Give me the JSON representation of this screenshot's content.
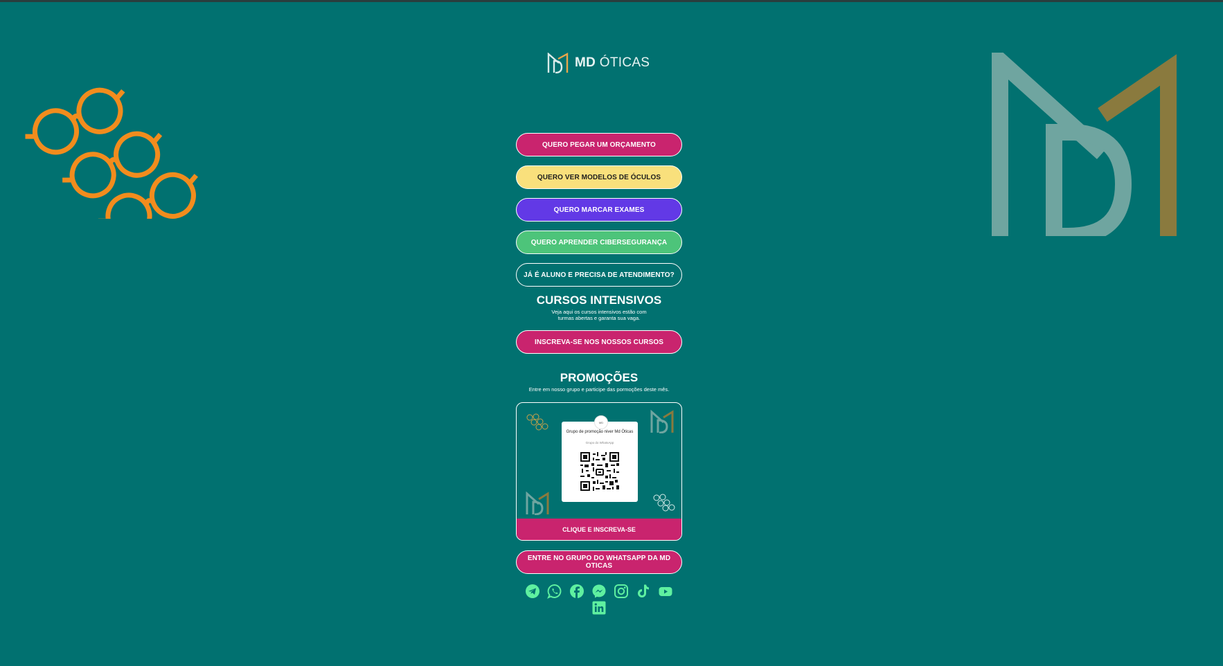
{
  "colors": {
    "background": "#017170",
    "accent_pink": "#c9246e",
    "accent_yellow": "#f9e07c",
    "accent_purple": "#6239e6",
    "accent_green": "#4dc47a",
    "social_green": "#5ff0a0",
    "decor_orange": "#f28c1d",
    "decor_gold": "#8a7a3e"
  },
  "brand": {
    "logo_bold": "MD",
    "logo_light": "ÓTICAS"
  },
  "buttons": [
    {
      "label": "QUERO PEGAR UM ORÇAMENTO",
      "color": "#c9246e",
      "text_color": "#ffffff"
    },
    {
      "label": "QUERO VER MODELOS DE ÓCULOS",
      "color": "#f9e07c",
      "text_color": "#1d1d1d"
    },
    {
      "label": "QUERO MARCAR EXAMES",
      "color": "#6239e6",
      "text_color": "#ffffff"
    },
    {
      "label": "QUERO APRENDER CIBERSEGURANÇA",
      "color": "#4dc47a",
      "text_color": "#ffffff"
    },
    {
      "label": "JÁ É ALUNO E PRECISA DE ATENDIMENTO?",
      "color": "transparent",
      "text_color": "#ffffff"
    }
  ],
  "courses": {
    "title": "CURSOS INTENSIVOS",
    "subtitle_line1": "Veja aqui os cursos intensivos estão com",
    "subtitle_line2": "turmas abertas e garanta sua vaga.",
    "button": "INSCREVA-SE NOS NOSSOS CURSOS"
  },
  "promotions": {
    "title": "PROMOÇÕES",
    "subtitle": "Entre em nosso grupo e participe das pormoções deste mês.",
    "qr_title": "Grupo de promoção niver Md Óticas",
    "qr_subtitle": "Grupo do WhatsApp",
    "cta": "CLIQUE E INSCREVA-SE"
  },
  "whatsapp_button": "ENTRE NO GRUPO DO WHATSAPP DA MD OTICAS",
  "social_icons": [
    "telegram-icon",
    "whatsapp-icon",
    "facebook-icon",
    "messenger-icon",
    "instagram-icon",
    "tiktok-icon",
    "youtube-icon",
    "linkedin-icon"
  ]
}
